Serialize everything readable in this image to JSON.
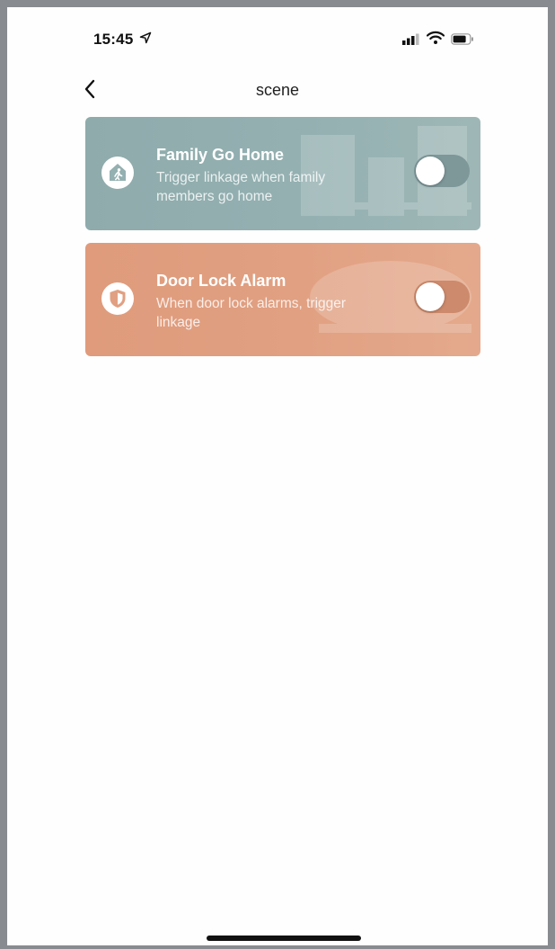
{
  "status_bar": {
    "time": "15:45",
    "icons": [
      "location-arrow-icon",
      "signal-icon",
      "wifi-icon",
      "battery-icon"
    ]
  },
  "nav": {
    "back_icon": "chevron-left-icon",
    "title": "scene"
  },
  "scenes": [
    {
      "title": "Family Go Home",
      "description": "Trigger linkage when family members go home",
      "icon": "home-walking-person-icon",
      "enabled": false,
      "color": "#94b0b1"
    },
    {
      "title": "Door Lock Alarm",
      "description": "When door lock alarms, trigger linkage",
      "icon": "shield-icon",
      "enabled": false,
      "color": "#e1a082"
    }
  ]
}
